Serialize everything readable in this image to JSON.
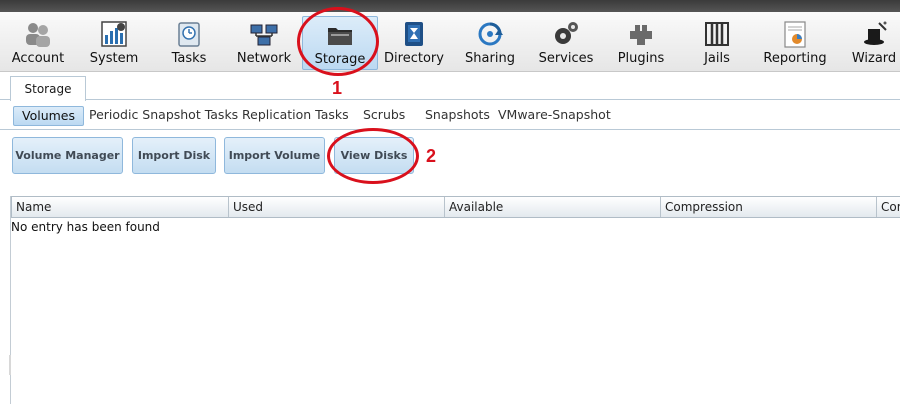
{
  "toolbar": {
    "items": [
      {
        "label": "Account",
        "icon": "account-icon"
      },
      {
        "label": "System",
        "icon": "system-icon"
      },
      {
        "label": "Tasks",
        "icon": "tasks-icon"
      },
      {
        "label": "Network",
        "icon": "network-icon"
      },
      {
        "label": "Storage",
        "icon": "storage-icon"
      },
      {
        "label": "Directory",
        "icon": "directory-icon"
      },
      {
        "label": "Sharing",
        "icon": "sharing-icon"
      },
      {
        "label": "Services",
        "icon": "services-icon"
      },
      {
        "label": "Plugins",
        "icon": "plugins-icon"
      },
      {
        "label": "Jails",
        "icon": "jails-icon"
      },
      {
        "label": "Reporting",
        "icon": "reporting-icon"
      },
      {
        "label": "Wizard",
        "icon": "wizard-icon"
      }
    ],
    "active": "Storage"
  },
  "tabs": [
    {
      "label": "Storage"
    }
  ],
  "subnav": [
    {
      "label": "Volumes"
    },
    {
      "label": "Periodic Snapshot Tasks"
    },
    {
      "label": "Replication Tasks"
    },
    {
      "label": "Scrubs"
    },
    {
      "label": "Snapshots"
    },
    {
      "label": "VMware-Snapshot"
    }
  ],
  "actions": [
    {
      "label": "Volume Manager"
    },
    {
      "label": "Import Disk"
    },
    {
      "label": "Import Volume"
    },
    {
      "label": "View Disks"
    }
  ],
  "grid": {
    "columns": [
      "Name",
      "Used",
      "Available",
      "Compression",
      "Com"
    ],
    "empty_text": "No entry has been found"
  },
  "annotations": [
    {
      "number": "1"
    },
    {
      "number": "2"
    }
  ],
  "colors": {
    "annotation": "#d9101c",
    "active_button": "#bcd9f2"
  }
}
